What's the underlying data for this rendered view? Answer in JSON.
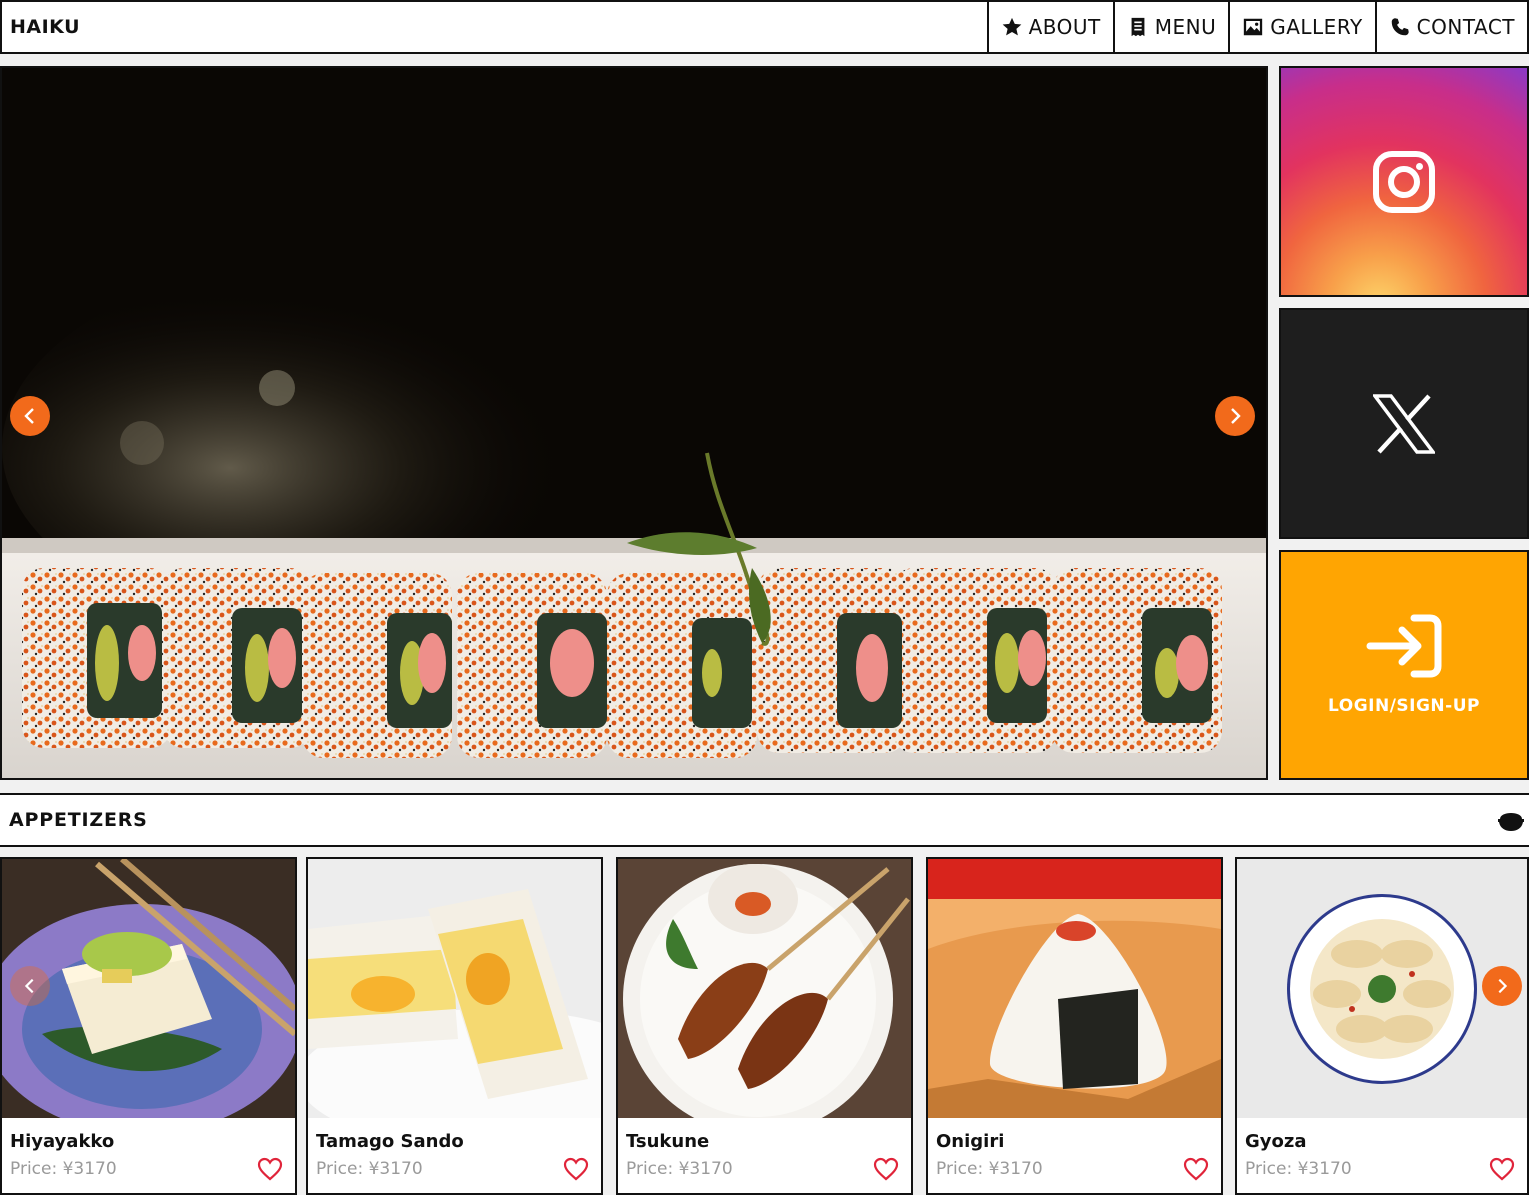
{
  "header": {
    "brand": "HAIKU",
    "nav": [
      {
        "label": "ABOUT",
        "icon": "star-icon"
      },
      {
        "label": "MENU",
        "icon": "receipt-icon"
      },
      {
        "label": "GALLERY",
        "icon": "image-icon"
      },
      {
        "label": "CONTACT",
        "icon": "phone-icon"
      }
    ]
  },
  "hero": {
    "image": "sushi-rolls-photo",
    "prev_icon": "chevron-left-icon",
    "next_icon": "chevron-right-icon"
  },
  "social": {
    "instagram_icon": "instagram-icon",
    "x_icon": "x-logo-icon",
    "login_icon": "login-arrow-icon",
    "login_label": "LOGIN/SIGN-UP"
  },
  "section": {
    "title": "APPETIZERS",
    "icon": "rice-bowl-icon"
  },
  "cards": [
    {
      "name": "Hiyayakko",
      "price": "Price: ¥3170"
    },
    {
      "name": "Tamago Sando",
      "price": "Price: ¥3170"
    },
    {
      "name": "Tsukune",
      "price": "Price: ¥3170"
    },
    {
      "name": "Onigiri",
      "price": "Price: ¥3170"
    },
    {
      "name": "Gyoza",
      "price": "Price: ¥3170"
    }
  ],
  "colors": {
    "accent_orange": "#f26a1b",
    "login_tile": "#ffa502",
    "x_tile": "#1e1e1e",
    "heart": "#e0243a"
  }
}
